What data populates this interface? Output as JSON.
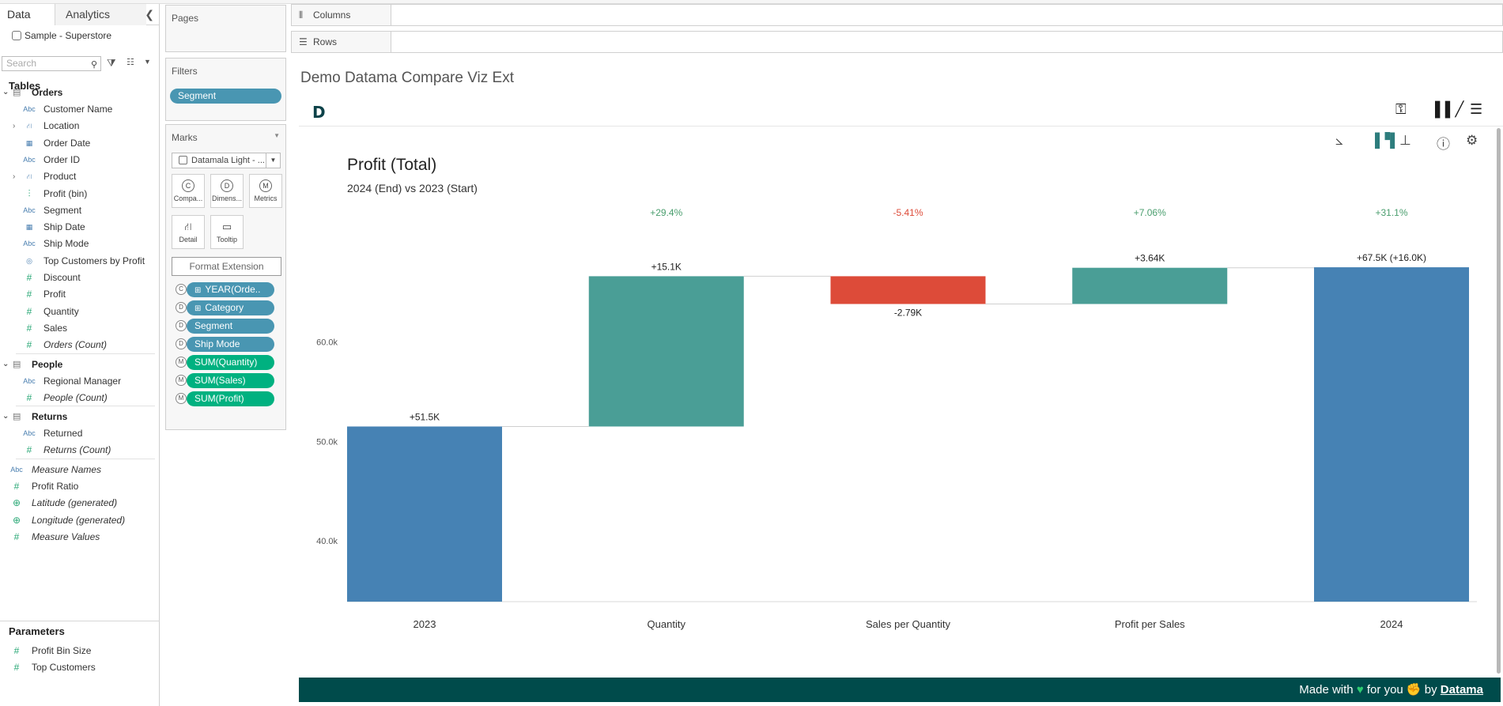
{
  "data_pane": {
    "tab_data": "Data",
    "tab_analytics": "Analytics",
    "datasource": "Sample - Superstore",
    "search_placeholder": "Search",
    "tables_title": "Tables",
    "groups": {
      "orders": "Orders",
      "people": "People",
      "returns": "Returns"
    },
    "orders_fields": [
      {
        "type": "Abc",
        "label": "Customer Name"
      },
      {
        "type": "hier",
        "label": "Location"
      },
      {
        "type": "date",
        "label": "Order Date"
      },
      {
        "type": "Abc",
        "label": "Order ID"
      },
      {
        "type": "hier",
        "label": "Product"
      },
      {
        "type": "bin",
        "label": "Profit (bin)"
      },
      {
        "type": "Abc",
        "label": "Segment"
      },
      {
        "type": "date",
        "label": "Ship Date"
      },
      {
        "type": "Abc",
        "label": "Ship Mode"
      },
      {
        "type": "set",
        "label": "Top Customers by Profit"
      },
      {
        "type": "#",
        "label": "Discount"
      },
      {
        "type": "#",
        "label": "Profit"
      },
      {
        "type": "#",
        "label": "Quantity"
      },
      {
        "type": "#",
        "label": "Sales"
      },
      {
        "type": "#",
        "label": "Orders (Count)"
      }
    ],
    "people_fields": [
      {
        "type": "Abc",
        "label": "Regional Manager"
      },
      {
        "type": "#",
        "label": "People (Count)"
      }
    ],
    "returns_fields": [
      {
        "type": "Abc",
        "label": "Returned"
      },
      {
        "type": "#",
        "label": "Returns (Count)"
      }
    ],
    "other_fields": [
      {
        "type": "Abc",
        "label": "Measure Names"
      },
      {
        "type": "#",
        "label": "Profit Ratio"
      },
      {
        "type": "globe",
        "label": "Latitude (generated)"
      },
      {
        "type": "globe",
        "label": "Longitude (generated)"
      },
      {
        "type": "#",
        "label": "Measure Values"
      }
    ],
    "parameters_title": "Parameters",
    "parameters": [
      {
        "type": "#",
        "label": "Profit Bin Size"
      },
      {
        "type": "#",
        "label": "Top Customers"
      }
    ]
  },
  "cards": {
    "pages_title": "Pages",
    "filters_title": "Filters",
    "filter_pill": "Segment",
    "marks_title": "Marks",
    "marks_type": "Datamala Light - ...",
    "mark_buttons": [
      {
        "glyph": "C",
        "label": "Compa..."
      },
      {
        "glyph": "D",
        "label": "Dimens..."
      },
      {
        "glyph": "M",
        "label": "Metrics"
      },
      {
        "glyph": "⛙",
        "label": "Detail"
      },
      {
        "glyph": "▭",
        "label": "Tooltip"
      }
    ],
    "format_button": "Format Extension",
    "mark_pills": [
      {
        "role": "C",
        "label": "YEAR(Orde..",
        "kind": "dim",
        "plus": true
      },
      {
        "role": "D",
        "label": "Category",
        "kind": "dim",
        "plus": true
      },
      {
        "role": "D",
        "label": "Segment",
        "kind": "dim",
        "plus": false
      },
      {
        "role": "D",
        "label": "Ship Mode",
        "kind": "dim",
        "plus": false
      },
      {
        "role": "M",
        "label": "SUM(Quantity)",
        "kind": "meas",
        "plus": false
      },
      {
        "role": "M",
        "label": "SUM(Sales)",
        "kind": "meas",
        "plus": false
      },
      {
        "role": "M",
        "label": "SUM(Profit)",
        "kind": "meas",
        "plus": false
      }
    ]
  },
  "shelves": {
    "columns": "Columns",
    "rows": "Rows"
  },
  "worksheet_title": "Demo Datama Compare Viz Ext",
  "extension": {
    "logo": "D",
    "footer_made_with": "Made with",
    "footer_for_you": "for you",
    "footer_by": "by",
    "footer_brand": "Datama"
  },
  "colors": {
    "total_bar": "#4682b4",
    "positive_bar": "#4a9e96",
    "negative_bar": "#dd4b39",
    "positive_pct": "#4a9e6e",
    "negative_pct": "#dd4b39",
    "footer_bg": "#004b4b"
  },
  "chart_data": {
    "type": "bar",
    "subtype": "waterfall",
    "title": "Profit (Total)",
    "subtitle": "2024 (End) vs 2023 (Start)",
    "categories": [
      "2023",
      "Quantity",
      "Sales per Quantity",
      "Profit per Sales",
      "2024"
    ],
    "kind": [
      "total",
      "delta",
      "delta",
      "delta",
      "total"
    ],
    "start": [
      0,
      51500,
      66600,
      63810,
      0
    ],
    "end": [
      51500,
      66600,
      63810,
      67450,
      67500
    ],
    "value_labels": [
      "+51.5K",
      "+15.1K",
      "-2.79K",
      "+3.64K",
      "+67.5K (+16.0K)"
    ],
    "pct_labels": [
      "",
      "+29.4%",
      "-5.41%",
      "+7.06%",
      "+31.1%"
    ],
    "y_ticks": [
      40000,
      50000,
      60000
    ],
    "y_tick_labels": [
      "40.0k",
      "50.0k",
      "60.0k"
    ],
    "ylim": [
      33900,
      68300
    ]
  }
}
